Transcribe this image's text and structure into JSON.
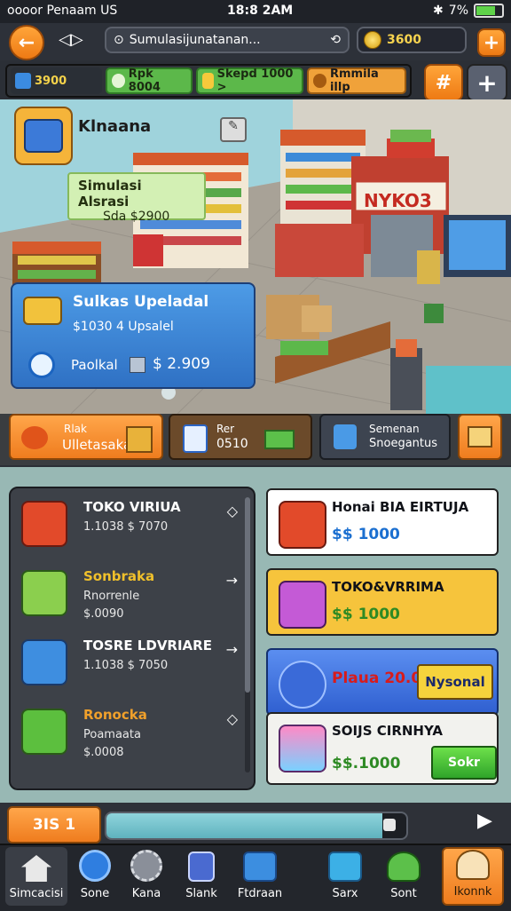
{
  "status": {
    "carrier": "oooor Penaam US",
    "time": "18:8 2AM",
    "battery": "7%"
  },
  "topbar": {
    "search_text": "Sumulasijunatanan...",
    "coins": "3600"
  },
  "resources": [
    {
      "value": "3900",
      "color": "#2a2f36"
    },
    {
      "value": "Rpk 8004",
      "color": "#4caf3a"
    },
    {
      "value": "Skepd 1000 >",
      "color": "#4caf3a"
    },
    {
      "value": "Rmmila illp",
      "color": "#d98f1a"
    }
  ],
  "scene": {
    "store_title": "Klnaana",
    "sim_box": {
      "title": "Simulasi Alsrasi",
      "value": "Sda $2900"
    },
    "shop_sign": "NYKO3",
    "info_card": {
      "title": "Sulkas Upeladal",
      "subtitle": "$1030 4 Upsalel",
      "label": "Paolkal",
      "price": "$ 2.909"
    }
  },
  "actions": [
    {
      "line1": "Rlak",
      "line2": "Ulletasaka"
    },
    {
      "line1": "Rer",
      "line2": "0510"
    },
    {
      "line1": "Semenan",
      "line2": "Snoegantus"
    }
  ],
  "list": [
    {
      "title": "TOKO VIRIUA",
      "line1": "1.1038 $ 7070",
      "line2": "",
      "title_color": "#ffffff"
    },
    {
      "title": "Sonbraka",
      "line1": "Rnorrenle",
      "line2": "$.0090",
      "title_color": "#f0c02b"
    },
    {
      "title": "TOSRE LDVRIARE",
      "line1": "1.1038 $ 7050",
      "line2": "",
      "title_color": "#ffffff"
    },
    {
      "title": "Ronocka",
      "line1": "Poamaata",
      "line2": "$.0008",
      "title_color": "#f0a02b"
    }
  ],
  "cards": [
    {
      "title": "Honai BIA EIRTUJA",
      "price": "$$ 1000",
      "bg": "#ffffff"
    },
    {
      "title": "TOKO&VRRIMA",
      "price": "$$ 1000",
      "bg": "#f6c43c"
    },
    {
      "title": "Plaua 20.00",
      "btn": "Nysonal",
      "bg": "#3c6fe0"
    },
    {
      "title": "SOIJS CIRNHYA",
      "price": "$$.1000",
      "btn": "Sokr",
      "bg": "#f2f2ee"
    }
  ],
  "progress": {
    "label": "3IS 1",
    "fill": 0.92
  },
  "nav": [
    {
      "label": "Simcacisi"
    },
    {
      "label": "Sone"
    },
    {
      "label": "Kana"
    },
    {
      "label": "Slank"
    },
    {
      "label": "Ftdraan"
    },
    {
      "label": "Sarx"
    },
    {
      "label": "Sont"
    },
    {
      "label": "Ikonnk"
    }
  ]
}
